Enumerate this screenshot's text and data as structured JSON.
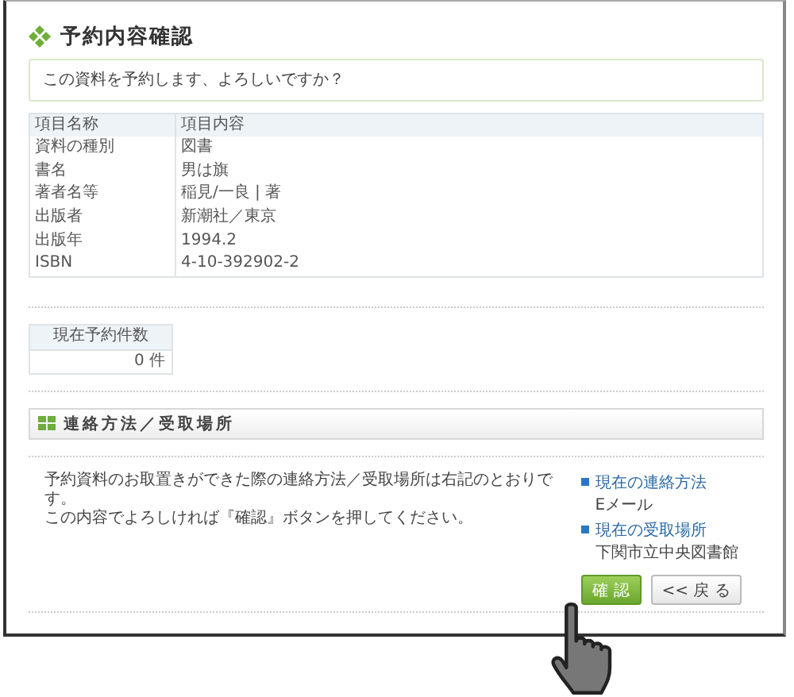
{
  "title": "予約内容確認",
  "message": "この資料を予約します、よろしいですか？",
  "table": {
    "columns": [
      "項目名称",
      "項目内容"
    ],
    "rows": [
      [
        "資料の種別",
        "図書"
      ],
      [
        "書名",
        "男は旗"
      ],
      [
        "著者名等",
        "稲見/一良 | 著"
      ],
      [
        "出版者",
        "新潮社／東京"
      ],
      [
        "出版年",
        "1994.2"
      ],
      [
        "ISBN",
        "4-10-392902-2"
      ]
    ]
  },
  "reservation_count": {
    "label": "現在予約件数",
    "value": "0 件"
  },
  "section": {
    "title": "連絡方法／受取場所"
  },
  "note": [
    "予約資料のお取置きができた際の連絡方法／受取場所は右記のとおりです。",
    "この内容でよろしければ『確認』ボタンを押してください。"
  ],
  "contact": [
    {
      "label": "現在の連絡方法",
      "value": "Eメール"
    },
    {
      "label": "現在の受取場所",
      "value": "下関市立中央図書館"
    }
  ],
  "buttons": [
    {
      "label": "確 認",
      "kind": "primary"
    },
    {
      "label": "<< 戻 る",
      "kind": "secondary"
    }
  ]
}
